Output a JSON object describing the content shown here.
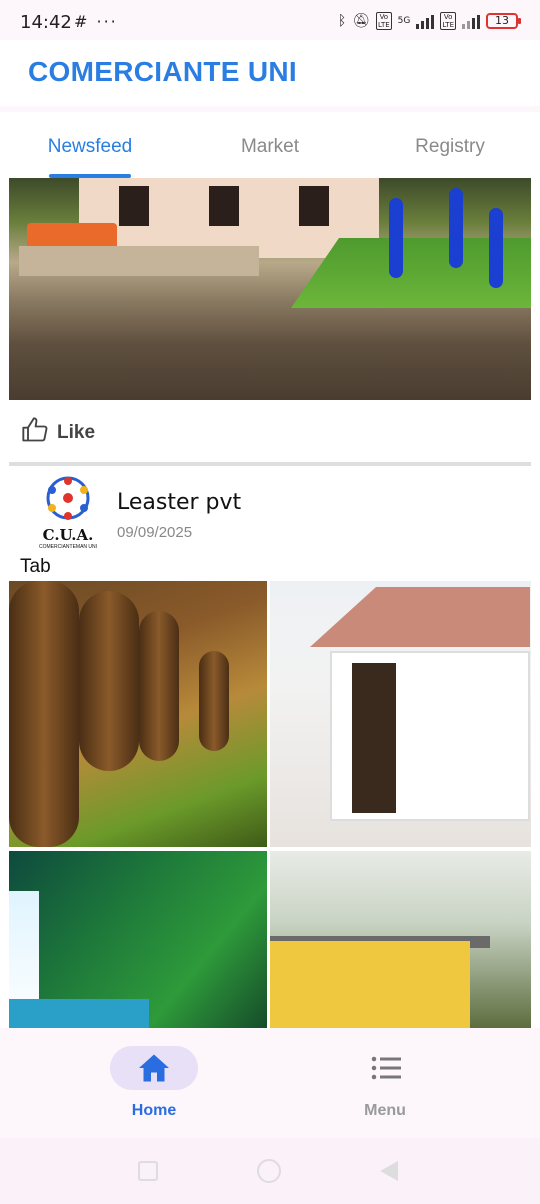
{
  "status_bar": {
    "time": "14:42",
    "left_icons": "# ···",
    "network": "5G",
    "battery": "13"
  },
  "app": {
    "title": "COMERCIANTE UNI",
    "accent_color": "#2a7de1"
  },
  "tabs": [
    {
      "label": "Newsfeed",
      "active": true
    },
    {
      "label": "Market",
      "active": false
    },
    {
      "label": "Registry",
      "active": false
    }
  ],
  "feed": {
    "post1": {
      "like_label": "Like"
    },
    "post2": {
      "avatar_logo": "C.U.A.",
      "avatar_sub": "COMERCIANTEMAN UNI",
      "author": "Leaster pvt",
      "date": "09/09/2025",
      "text": "Tab"
    }
  },
  "bottom_nav": [
    {
      "label": "Home",
      "icon": "home-icon",
      "active": true
    },
    {
      "label": "Menu",
      "icon": "menu-icon",
      "active": false
    }
  ]
}
